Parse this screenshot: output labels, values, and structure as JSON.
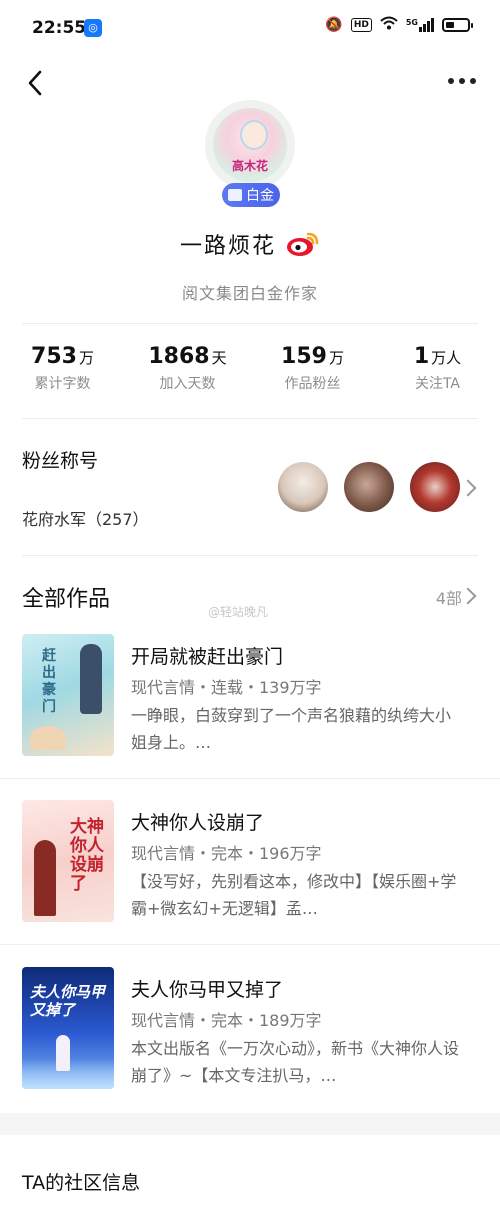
{
  "status_bar": {
    "time": "22:55",
    "hd": "HD",
    "signal": "5G"
  },
  "profile": {
    "avatar_text": "高木花",
    "badge": "白金",
    "name": "一路烦花",
    "subtitle": "阅文集团白金作家"
  },
  "stats": [
    {
      "value": "753",
      "unit": "万",
      "label": "累计字数"
    },
    {
      "value": "1868",
      "unit": "天",
      "label": "加入天数"
    },
    {
      "value": "159",
      "unit": "万",
      "label": "作品粉丝"
    },
    {
      "value": "1",
      "unit": "万人",
      "label": "关注TA"
    }
  ],
  "fans": {
    "title": "粉丝称号",
    "group": "花府水军（257）"
  },
  "works": {
    "title": "全部作品",
    "count": "4部",
    "watermark": "@轻站晚凡",
    "items": [
      {
        "title": "开局就被赶出豪门",
        "meta": "现代言情・连载・139万字",
        "desc": "一睁眼，白蔹穿到了一个声名狼藉的纨绔大小姐身上。…",
        "cover_text": "赶出豪门"
      },
      {
        "title": "大神你人设崩了",
        "meta": "现代言情・完本・196万字",
        "desc": "【没写好，先别看这本，修改中】【娱乐圈+学霸+微玄幻+无逻辑】孟…",
        "cover_text": "大神你人设崩了"
      },
      {
        "title": "夫人你马甲又掉了",
        "meta": "现代言情・完本・189万字",
        "desc": "本文出版名《一万次心动》，新书《大神你人设崩了》~【本文专注扒马，…",
        "cover_text": "夫人你马甲又掉了"
      }
    ]
  },
  "community": {
    "title": "TA的社区信息"
  },
  "colors": {
    "badge": "#4a63e8",
    "weibo_red": "#e6162d"
  }
}
